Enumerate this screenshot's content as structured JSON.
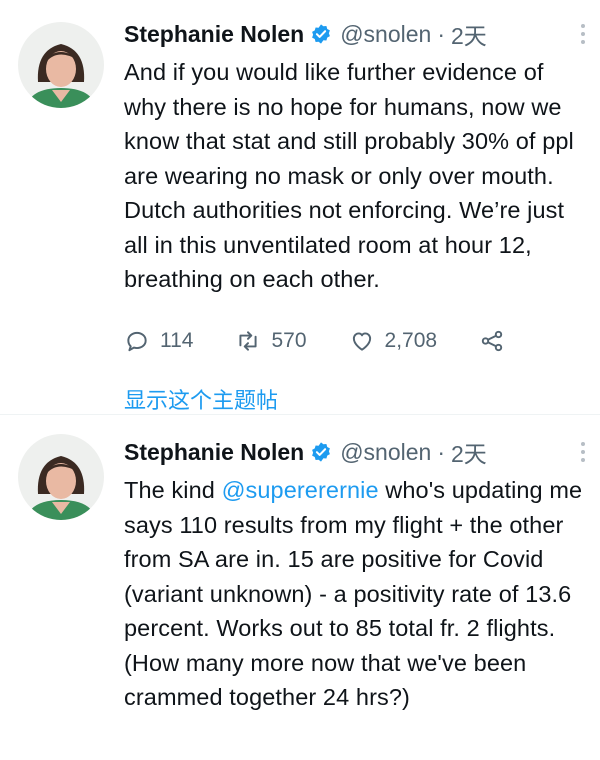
{
  "tweets": [
    {
      "name": "Stephanie Nolen",
      "handle": "@snolen",
      "separator": "·",
      "time": "2天",
      "text": "And if you would like further evidence of why there is no hope for humans, now we know that stat and still probably 30% of ppl are wearing no mask or only over mouth. Dutch authorities not enforcing. We’re just all in this unventilated room at hour 12, breathing on each other.",
      "replies": "114",
      "retweets": "570",
      "likes": "2,708",
      "show_thread": "显示这个主题帖"
    },
    {
      "name": "Stephanie Nolen",
      "handle": "@snolen",
      "separator": "·",
      "time": "2天",
      "text_before": "The kind ",
      "mention": "@supererernie",
      "text_after": " who's updating me says 110 results from my flight + the other from SA are in. 15 are positive for Covid (variant unknown) - a positivity rate of 13.6 percent. Works out to 85 total fr. 2 flights. (How many more now that we've been crammed together 24 hrs?)"
    }
  ],
  "colors": {
    "accent": "#1d9bf0",
    "secondary_text": "#536471",
    "avatar_bg": "#3a8f5a"
  },
  "icons": [
    "verified-badge-icon",
    "more-icon",
    "reply-icon",
    "retweet-icon",
    "like-icon",
    "share-icon"
  ]
}
